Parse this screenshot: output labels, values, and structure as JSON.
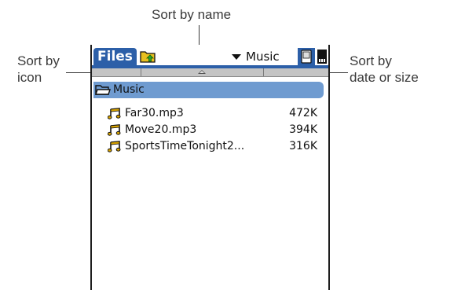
{
  "callouts": {
    "top": "Sort by name",
    "left": [
      "Sort by",
      "icon"
    ],
    "right": [
      "Sort by",
      "date or size"
    ]
  },
  "titlebar": {
    "tab_label": "Files",
    "category": "Music"
  },
  "folder": {
    "name": "Music"
  },
  "files": [
    {
      "name": "Far30.mp3",
      "size": "472K"
    },
    {
      "name": "Move20.mp3",
      "size": "394K"
    },
    {
      "name": "SportsTimeTonight2...",
      "size": "316K"
    }
  ],
  "colors": {
    "accent": "#2c5fa8",
    "selection": "#6f9bd0",
    "music_icon": "#d9a400",
    "folder_icon": "#e8c020"
  },
  "icons": {
    "folder_up": "folder-up-icon",
    "dropdown": "triangle-down-icon",
    "handheld": "handheld-icon",
    "card": "memory-card-icon",
    "sort_caret": "caret-up-icon",
    "folder": "open-folder-icon",
    "file": "music-note-icon"
  }
}
